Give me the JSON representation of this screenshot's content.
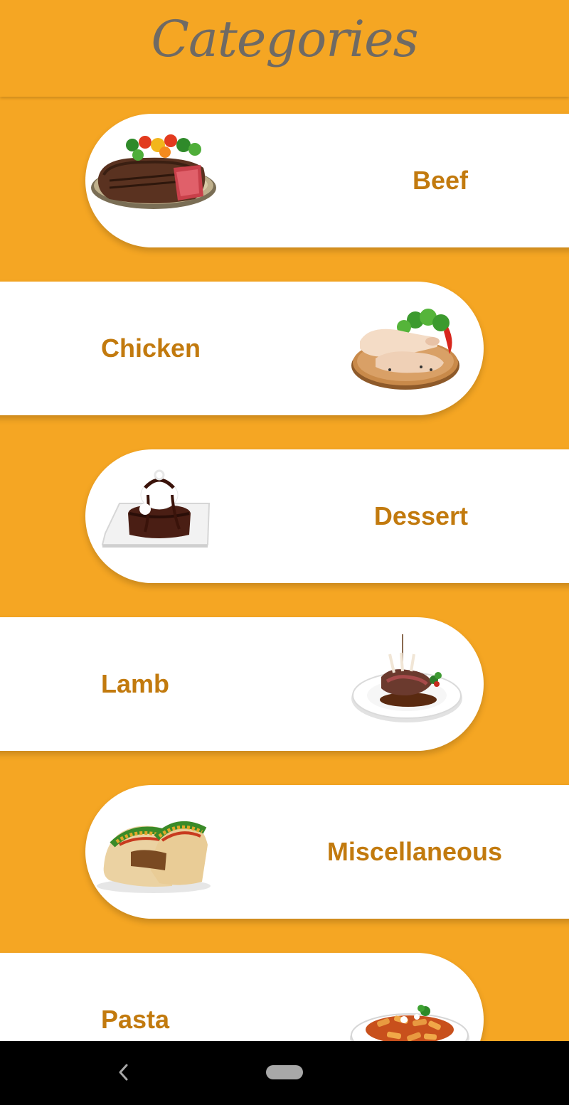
{
  "header": {
    "title": "Categories"
  },
  "categories": [
    {
      "label": "Beef",
      "icon": "beef-steak-plate-image"
    },
    {
      "label": "Chicken",
      "icon": "chicken-legs-board-image"
    },
    {
      "label": "Dessert",
      "icon": "chocolate-dessert-plate-image"
    },
    {
      "label": "Lamb",
      "icon": "lamb-chops-plate-image"
    },
    {
      "label": "Miscellaneous",
      "icon": "tacos-image"
    },
    {
      "label": "Pasta",
      "icon": "pasta-bowl-image"
    }
  ],
  "colors": {
    "background": "#F5A623",
    "card": "#FFFFFF",
    "label": "#C27A0E",
    "title": "#6F6A64",
    "navbar": "#000000"
  },
  "navbar": {
    "back_icon": "back-chevron-icon",
    "home_icon": "home-pill-icon"
  }
}
